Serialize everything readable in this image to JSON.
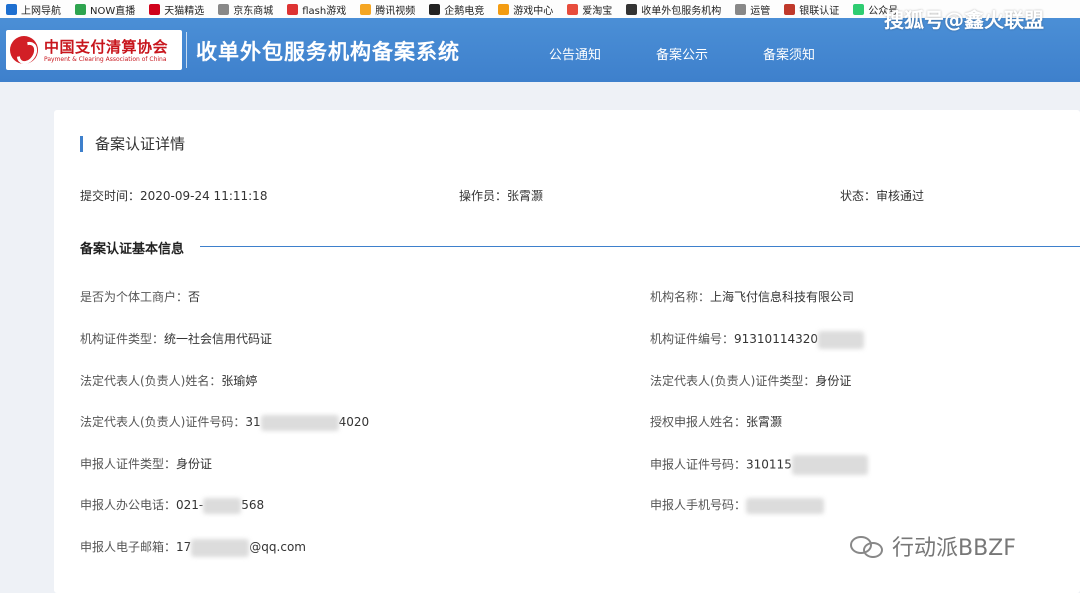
{
  "bookmarks": [
    {
      "label": "上网导航",
      "icon": "ie-icon",
      "color": "#1e6fd0"
    },
    {
      "label": "NOW直播",
      "icon": "now-icon",
      "color": "#2ea44f"
    },
    {
      "label": "天猫精选",
      "icon": "tmall-icon",
      "color": "#d0021b"
    },
    {
      "label": "京东商城",
      "icon": "globe-icon",
      "color": "#888888"
    },
    {
      "label": "flash游戏",
      "icon": "flash-icon",
      "color": "#d33"
    },
    {
      "label": "腾讯视频",
      "icon": "video-icon",
      "color": "#f5a623"
    },
    {
      "label": "企鹅电竞",
      "icon": "penguin-icon",
      "color": "#222"
    },
    {
      "label": "游戏中心",
      "icon": "gamepad-icon",
      "color": "#f39c12"
    },
    {
      "label": "爱淘宝",
      "icon": "taobao-icon",
      "color": "#e74c3c"
    },
    {
      "label": "收单外包服务机构",
      "icon": "page-icon",
      "color": "#333"
    },
    {
      "label": "运管",
      "icon": "globe-icon",
      "color": "#888888"
    },
    {
      "label": "银联认证",
      "icon": "unionpay-icon",
      "color": "#c0392b"
    },
    {
      "label": "公众号",
      "icon": "wechat-icon",
      "color": "#2ecc71"
    }
  ],
  "header": {
    "org_cn": "中国支付清算协会",
    "org_en": "Payment & Clearing Association of China",
    "system_title": "收单外包服务机构备案系统",
    "nav": [
      "公告通知",
      "备案公示",
      "备案须知"
    ]
  },
  "watermark_top": "搜狐号@鑫火联盟",
  "detail": {
    "title": "备案认证详情",
    "submit_time": "提交时间：2020-09-24 11:11:18",
    "operator": "操作员：张霄灏",
    "status": "状态：审核通过"
  },
  "basic_info": {
    "title": "备案认证基本信息",
    "fields": {
      "individual": {
        "label": "是否为个体工商户：",
        "value": "否"
      },
      "org_name": {
        "label": "机构名称：",
        "value": "上海飞付信息科技有限公司"
      },
      "cert_type": {
        "label": "机构证件类型：",
        "value": "统一社会信用代码证"
      },
      "cert_no": {
        "label": "机构证件编号：",
        "value": "91310114320"
      },
      "legal_name": {
        "label": "法定代表人(负责人)姓名：",
        "value": "张瑜婷"
      },
      "legal_cert_type": {
        "label": "法定代表人(负责人)证件类型：",
        "value": "身份证"
      },
      "legal_cert_no": {
        "label": "法定代表人(负责人)证件号码：",
        "value_start": "31",
        "value_end": "4020"
      },
      "applicant_name": {
        "label": "授权申报人姓名：",
        "value": "张霄灏"
      },
      "applicant_cert_type": {
        "label": "申报人证件类型：",
        "value": "身份证"
      },
      "applicant_cert_no": {
        "label": "申报人证件号码：",
        "value": "310115"
      },
      "office_phone": {
        "label": "申报人办公电话：",
        "value_start": "021-",
        "value_end": "568"
      },
      "mobile": {
        "label": "申报人手机号码：",
        "value": ""
      },
      "email": {
        "label": "申报人电子邮箱：",
        "value_start": "17",
        "value_end": "@qq.com"
      }
    }
  },
  "watermark_bottom": "行动派BBZF"
}
